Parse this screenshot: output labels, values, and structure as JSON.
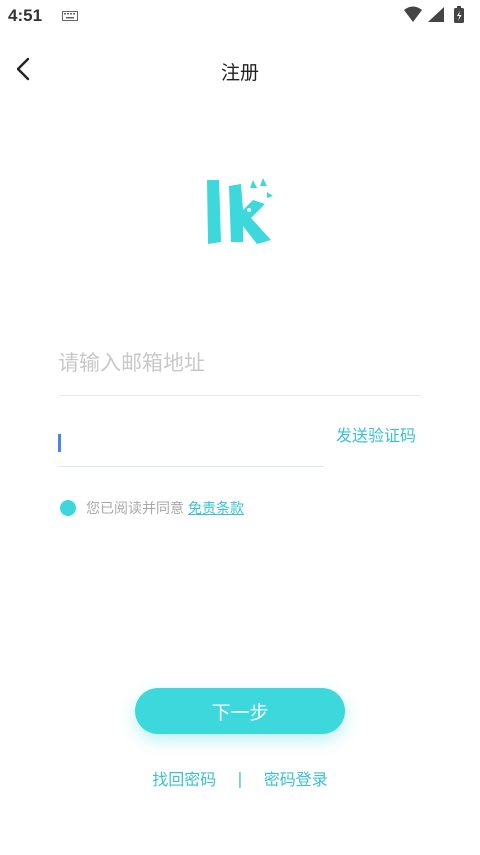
{
  "status_bar": {
    "time": "4:51",
    "icons": [
      "keyboard-icon",
      "wifi-icon",
      "signal-icon",
      "battery-icon"
    ]
  },
  "header": {
    "title": "注册",
    "back_icon": "back-arrow-icon"
  },
  "form": {
    "email_placeholder": "请输入邮箱地址",
    "email_value": "",
    "code_value": "",
    "send_code_label": "发送验证码",
    "agreement_text": "您已阅读并同意",
    "terms_link": "免责条款",
    "agreement_checked": true
  },
  "actions": {
    "next_label": "下一步",
    "recover_password": "找回密码",
    "separator": "|",
    "password_login": "密码登录"
  },
  "colors": {
    "accent": "#3cd8dc",
    "link": "#3cc2cf",
    "caret": "#4a86e8"
  }
}
